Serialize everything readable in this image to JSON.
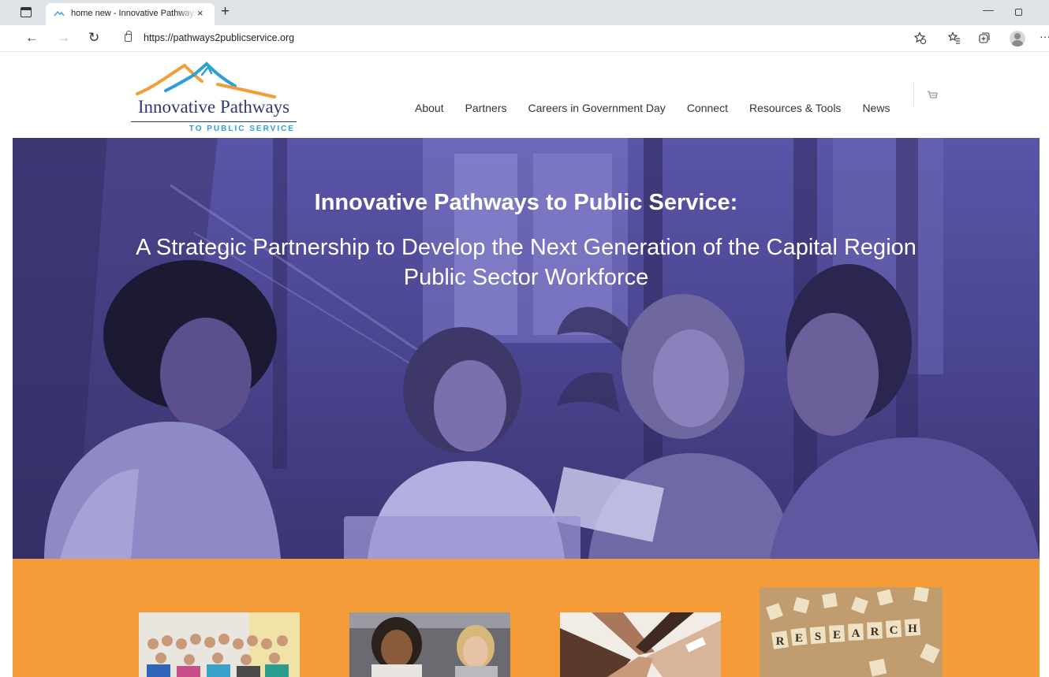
{
  "browser": {
    "tab_title": "home new - Innovative Pathways",
    "tab_close": "×",
    "new_tab": "+",
    "url": "https://pathways2publicservice.org",
    "back": "←",
    "forward": "→",
    "reload": "↻",
    "minimize": "—",
    "toolbar_icons": [
      "favorites-add-icon",
      "favorites-icon",
      "collections-icon",
      "profile-icon"
    ],
    "more": "···"
  },
  "site": {
    "logo": {
      "title": "Innovative Pathways",
      "subtitle": "TO PUBLIC SERVICE",
      "colors": {
        "navy": "#2d3a6e",
        "blue": "#2a9fd8",
        "orange": "#f59c38"
      }
    },
    "nav": [
      {
        "label": "About"
      },
      {
        "label": "Partners"
      },
      {
        "label": "Careers in Government Day"
      },
      {
        "label": "Connect"
      },
      {
        "label": "Resources & Tools"
      },
      {
        "label": "News"
      }
    ]
  },
  "hero": {
    "title": "Innovative Pathways to Public Service:",
    "subtitle": "A Strategic Partnership to Develop the Next Generation of the Capital Region Public Sector Workforce",
    "overlay_color": "#4c4793"
  },
  "band": {
    "color": "#f59c38",
    "cards": [
      {
        "name": "group-photo"
      },
      {
        "name": "meeting-photo"
      },
      {
        "name": "hands-photo"
      },
      {
        "name": "research-tiles-photo",
        "tiles": [
          "R",
          "E",
          "S",
          "E",
          "A",
          "R",
          "C",
          "H"
        ]
      }
    ]
  }
}
